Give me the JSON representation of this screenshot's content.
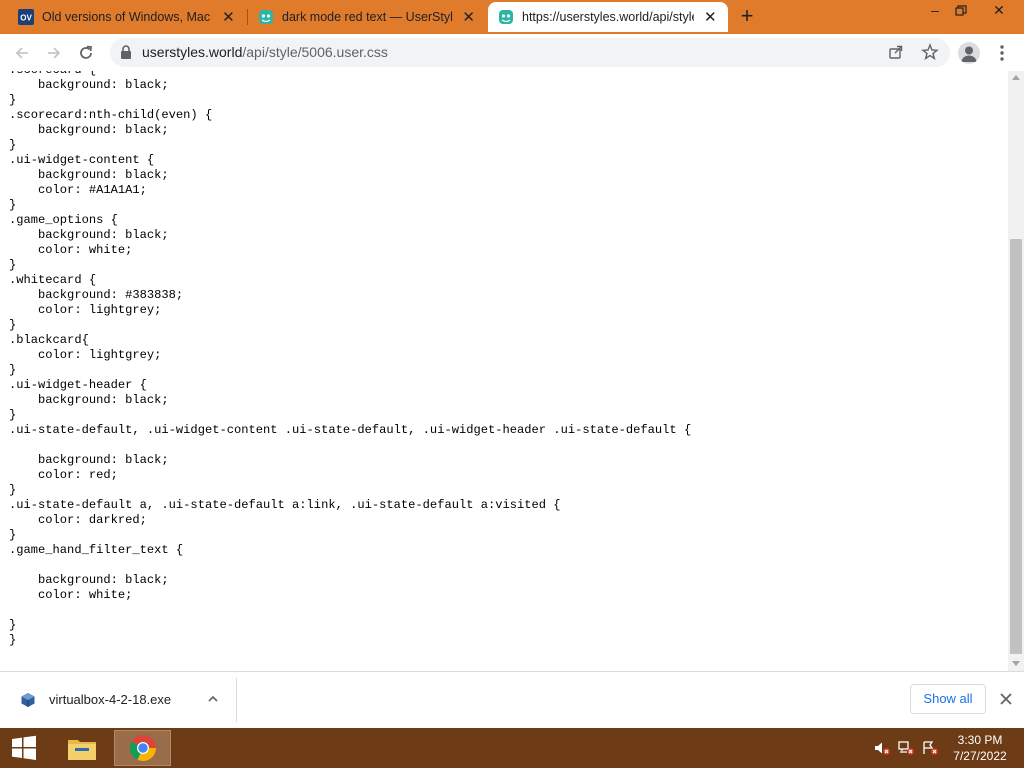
{
  "browser": {
    "tabs": [
      {
        "title": "Old versions of Windows, Mac a",
        "favicon": "oldversion-favicon",
        "favicon_text": "OV",
        "active": false
      },
      {
        "title": "dark mode red text — UserStyles",
        "favicon": "userstyles-favicon",
        "active": false
      },
      {
        "title": "https://userstyles.world/api/style",
        "favicon": "userstyles-favicon",
        "active": true
      }
    ],
    "new_tab_icon": "plus-icon",
    "window_controls": [
      "minimize-icon",
      "restore-icon",
      "close-icon"
    ]
  },
  "toolbar": {
    "back_icon": "back-arrow-icon",
    "forward_icon": "forward-arrow-icon",
    "reload_icon": "reload-icon",
    "url_host": "userstyles.world",
    "url_path": "/api/style/5006.user.css",
    "lock_icon": "lock-icon",
    "share_icon": "share-icon",
    "bookmark_icon": "star-icon",
    "profile_icon": "profile-avatar-icon",
    "menu_icon": "kebab-menu-icon"
  },
  "page": {
    "code_lines": [
      ".scorecard {",
      "    background: black;",
      "}",
      ".scorecard:nth-child(even) {",
      "    background: black;",
      "}",
      ".ui-widget-content {",
      "    background: black;",
      "    color: #A1A1A1;",
      "}",
      ".game_options {",
      "    background: black;",
      "    color: white;",
      "}",
      ".whitecard {",
      "    background: #383838;",
      "    color: lightgrey;",
      "}",
      ".blackcard{",
      "    color: lightgrey;",
      "}",
      ".ui-widget-header {",
      "    background: black;",
      "}",
      ".ui-state-default, .ui-widget-content .ui-state-default, .ui-widget-header .ui-state-default {",
      "",
      "    background: black;",
      "    color: red;",
      "}",
      ".ui-state-default a, .ui-state-default a:link, .ui-state-default a:visited {",
      "    color: darkred;",
      "}",
      ".game_hand_filter_text {",
      "",
      "    background: black;",
      "    color: white;",
      "",
      "}",
      "}"
    ]
  },
  "downloads": {
    "file_name": "virtualbox-4-2-18.exe",
    "file_icon": "virtualbox-file-icon",
    "show_all_label": "Show all",
    "close_icon": "close-icon"
  },
  "taskbar": {
    "start_icon": "windows-start-icon",
    "pinned": [
      "file-explorer-icon",
      "chrome-icon"
    ],
    "tray_icons": [
      "volume-muted-icon",
      "network-icon",
      "action-center-icon"
    ],
    "time": "3:30 PM",
    "date": "7/27/2022"
  },
  "colors": {
    "tabstrip": "#e07b2c",
    "taskbar": "#6d3b16",
    "active_tab": "#ffffff",
    "link_blue": "#1a73e8"
  }
}
